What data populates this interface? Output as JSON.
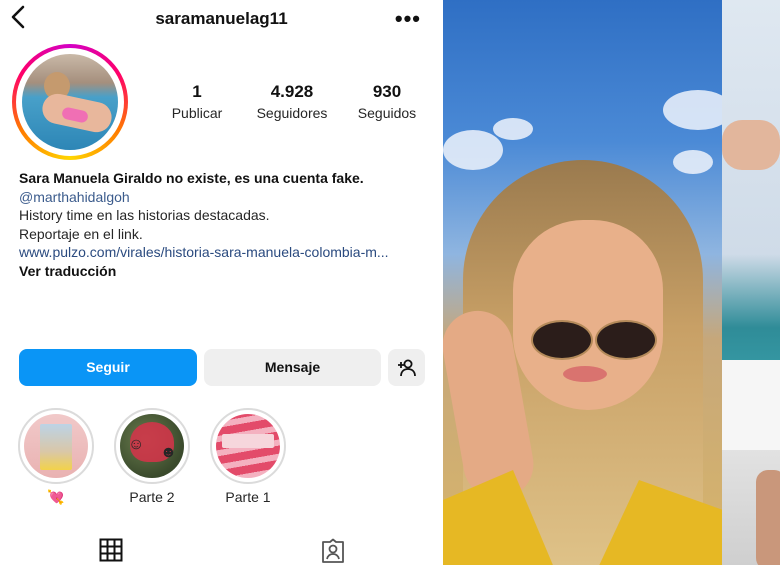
{
  "header": {
    "username": "saramanuelag11",
    "back_icon": "chevron-left-icon",
    "more_icon": "more-horizontal-icon",
    "more_label": "•••"
  },
  "stats": [
    {
      "value": "1",
      "label": "Publicar"
    },
    {
      "value": "4.928",
      "label": "Seguidores"
    },
    {
      "value": "930",
      "label": "Seguidos"
    }
  ],
  "bio": {
    "name": "Sara Manuela Giraldo no existe, es una cuenta fake.",
    "mention": "@marthahidalgoh",
    "line1": "History time en las historias destacadas.",
    "line2": "Reportaje en el link.",
    "link": "www.pulzo.com/virales/historia-sara-manuela-colombia-m...",
    "translate": "Ver traducción"
  },
  "actions": {
    "follow": "Seguir",
    "message": "Mensaje",
    "add_user_icon": "add-user-icon"
  },
  "highlights": [
    {
      "label": "💘"
    },
    {
      "label": "Parte 2"
    },
    {
      "label": "Parte 1"
    }
  ],
  "tabs": {
    "grid_icon": "grid-icon",
    "tagged_icon": "tagged-person-icon"
  },
  "colors": {
    "follow_button": "#0a95f6",
    "secondary_button": "#efefef",
    "link_text": "#2a4a7f"
  }
}
